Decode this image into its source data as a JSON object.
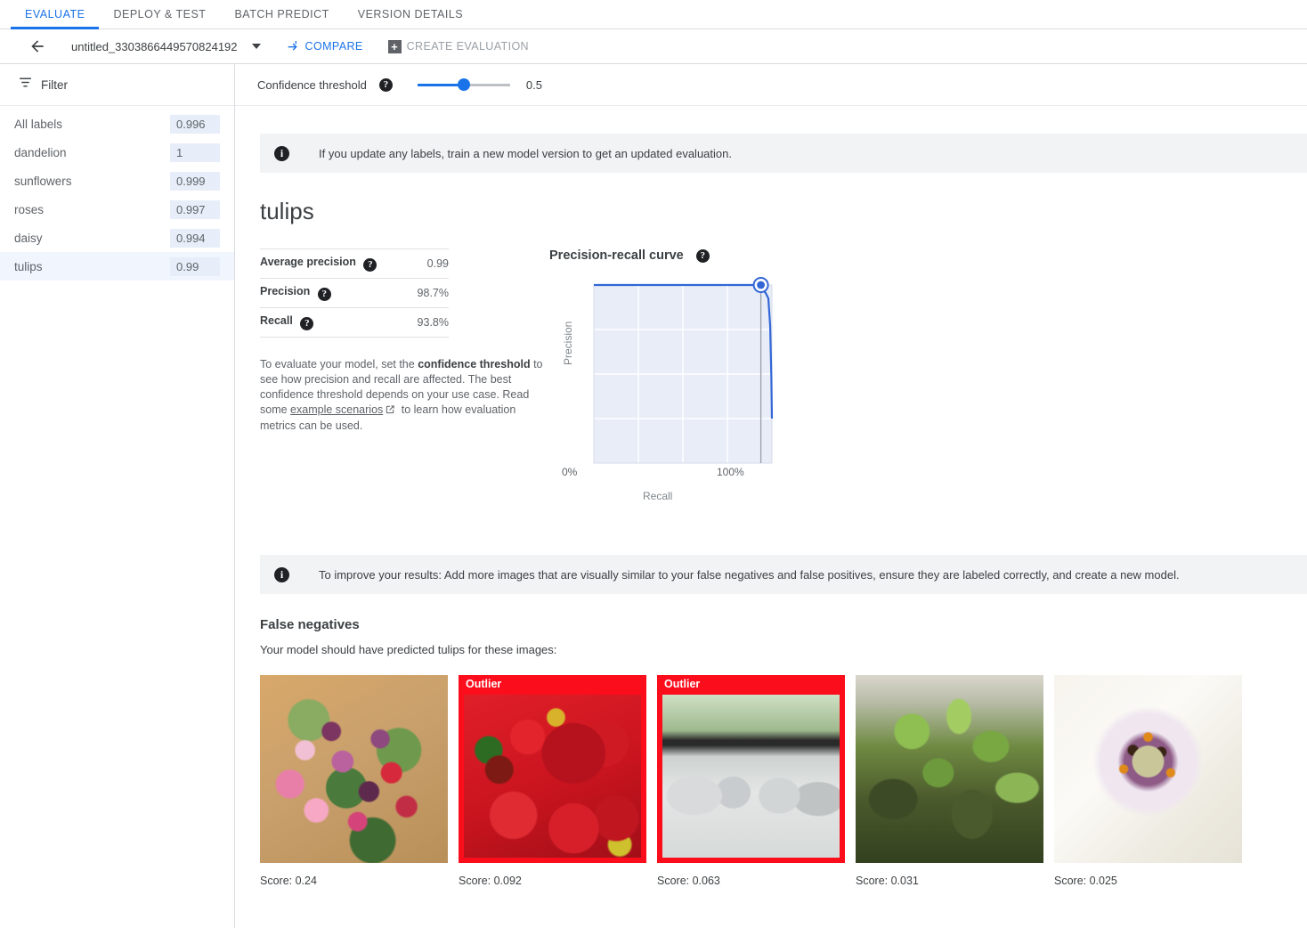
{
  "tabs": [
    {
      "label": "EVALUATE",
      "active": true
    },
    {
      "label": "DEPLOY & TEST",
      "active": false
    },
    {
      "label": "BATCH PREDICT",
      "active": false
    },
    {
      "label": "VERSION DETAILS",
      "active": false
    }
  ],
  "toolbar": {
    "back_icon": "arrow-left-icon",
    "model_name": "untitled_3303866449570824192",
    "dropdown_icon": "caret-down-icon",
    "compare_label": "COMPARE",
    "compare_icon": "compare-arrow-icon",
    "create_evaluation_label": "CREATE EVALUATION",
    "create_evaluation_icon": "plus-box-icon",
    "create_evaluation_disabled": true
  },
  "sidebar": {
    "filter_label": "Filter",
    "filter_icon": "filter-icon",
    "items": [
      {
        "label": "All labels",
        "score": "0.996",
        "selected": false
      },
      {
        "label": "dandelion",
        "score": "1",
        "selected": false
      },
      {
        "label": "sunflowers",
        "score": "0.999",
        "selected": false
      },
      {
        "label": "roses",
        "score": "0.997",
        "selected": false
      },
      {
        "label": "daisy",
        "score": "0.994",
        "selected": false
      },
      {
        "label": "tulips",
        "score": "0.99",
        "selected": true
      }
    ]
  },
  "confidence": {
    "label": "Confidence threshold",
    "help_icon": "help-icon",
    "value": "0.5",
    "slider_percent": 50
  },
  "top_banner": {
    "icon": "info-icon",
    "text": "If you update any labels, train a new model version to get an updated evaluation."
  },
  "evaluation": {
    "title": "tulips",
    "metrics": [
      {
        "name": "Average precision",
        "value": "0.99",
        "help_icon": "help-icon"
      },
      {
        "name": "Precision",
        "value": "98.7%",
        "help_icon": "help-icon"
      },
      {
        "name": "Recall",
        "value": "93.8%",
        "help_icon": "help-icon"
      }
    ],
    "description_part1": "To evaluate your model, set the ",
    "description_bold": "confidence threshold",
    "description_part2": " to see how precision and recall are affected. The best confidence threshold depends on your use case. Read some ",
    "description_link": "example scenarios",
    "description_link_icon": "external-link-icon",
    "description_part3": " to learn how evaluation metrics can be used."
  },
  "chart_data": {
    "type": "line",
    "title": "Precision-recall curve",
    "help_icon": "help-icon",
    "xlabel": "Recall",
    "ylabel": "Precision",
    "xlim": [
      0,
      100
    ],
    "ylim": [
      0,
      100
    ],
    "xtick_labels": [
      "0%",
      "100%"
    ],
    "xticks": [
      0,
      100
    ],
    "grid": true,
    "gridlines_x": [
      25,
      50,
      75
    ],
    "gridlines_y": [
      25,
      50,
      75
    ],
    "series": [
      {
        "name": "Precision-recall",
        "x": [
          0,
          20,
          50,
          75,
          90,
          93.8,
          95.5,
          97,
          98.5,
          99.5,
          100,
          100
        ],
        "y": [
          100,
          100,
          100,
          100,
          100,
          100,
          97,
          96,
          94,
          70,
          30,
          25
        ]
      }
    ],
    "marker": {
      "x": 93.8,
      "y": 100,
      "label": "current threshold"
    },
    "threshold_line_x": 93.8
  },
  "improve_banner": {
    "icon": "info-icon",
    "text": "To improve your results: Add more images that are visually similar to your false negatives and false positives, ensure they are labeled correctly, and create a new model."
  },
  "false_negatives": {
    "title": "False negatives",
    "subtitle": "Your model should have predicted tulips for these images:",
    "outlier_label": "Outlier",
    "items": [
      {
        "score_label": "Score: 0.24",
        "outlier": false,
        "alt": "pink and purple tulip bouquet on wooden floor"
      },
      {
        "score_label": "Score: 0.092",
        "outlier": true,
        "alt": "red colander full of strawberries"
      },
      {
        "score_label": "Score: 0.063",
        "outlier": true,
        "alt": "japanese garden hot spring with rocks and bridge"
      },
      {
        "score_label": "Score: 0.031",
        "outlier": false,
        "alt": "green leafy plants growing on mossy rock"
      },
      {
        "score_label": "Score: 0.025",
        "outlier": false,
        "alt": "close-up of white daisy flower center"
      }
    ]
  },
  "colors": {
    "accent": "#1a73e8",
    "outlier": "#fc0d1b",
    "chart_plot_bg": "#e8edf8",
    "chart_line": "#3367d6",
    "badge_bg": "#e8eef9",
    "selected_row": "#f1f5fd",
    "banner_bg": "#f1f3f4"
  }
}
